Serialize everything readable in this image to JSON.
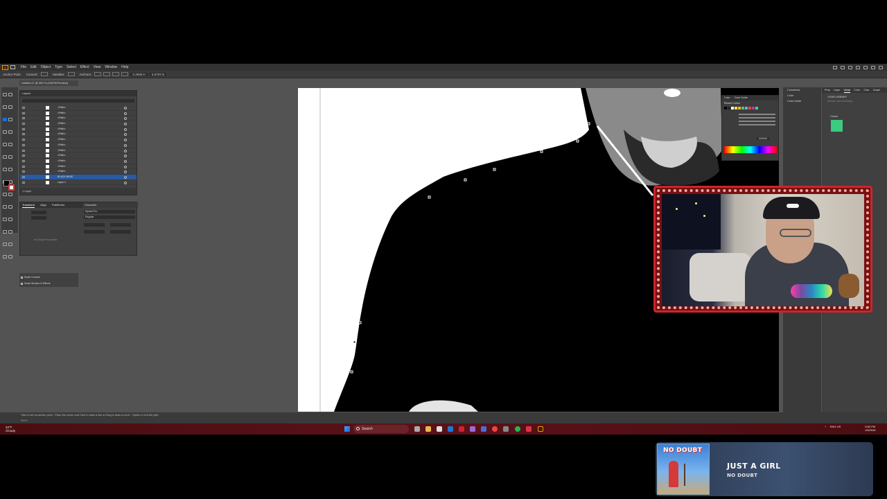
{
  "app": {
    "menu": [
      "File",
      "Edit",
      "Object",
      "Type",
      "Select",
      "Effect",
      "View",
      "Window",
      "Help"
    ],
    "control_bar": {
      "mode_label": "Anchor Point",
      "convert_label": "Convert:",
      "handles_label": "Handles:",
      "anchors_label": "Anchors:",
      "x_value": "5.3938 in",
      "y_value": "5.6703 in"
    },
    "doc_tab": "Untitled-1* @ 300 % (CMYK/Preview)"
  },
  "layers_panel": {
    "tabs": [
      "Layers"
    ],
    "rows": [
      {
        "name": "<Path>",
        "selected": false
      },
      {
        "name": "<Path>",
        "selected": false
      },
      {
        "name": "<Path>",
        "selected": false
      },
      {
        "name": "<Path>",
        "selected": false
      },
      {
        "name": "<Path>",
        "selected": false
      },
      {
        "name": "<Path>",
        "selected": false
      },
      {
        "name": "<Path>",
        "selected": false
      },
      {
        "name": "<Path>",
        "selected": false
      },
      {
        "name": "<Path>",
        "selected": false
      },
      {
        "name": "<Path>",
        "selected": false
      },
      {
        "name": "<Path>",
        "selected": false
      },
      {
        "name": "<Path>",
        "selected": false
      },
      {
        "name": "<Path>",
        "selected": false
      },
      {
        "name": "BLACK BASE",
        "selected": true
      },
      {
        "name": "Layer 1",
        "selected": false
      }
    ],
    "footer": "1 Layer"
  },
  "properties": {
    "tabs": [
      "Transform",
      "Align",
      "Pathfinder"
    ],
    "character_tab": "Character",
    "font_name": "Myriad Pro",
    "font_style": "Regular",
    "no_shape": "No Shape Properties",
    "scale_corners": "Scale Corners",
    "scale_strokes": "Scale Strokes & Effects"
  },
  "color_panel": {
    "tabs": [
      "Color",
      "Color Guide"
    ],
    "recent_label": "Recent Colors",
    "hex_value": "000000",
    "swatches": [
      "#000000",
      "#222222",
      "#ffffff",
      "#f4e04d",
      "#ffb13b",
      "#3ccb7f",
      "#7ad",
      "#e44",
      "#c39",
      "#2bd9a9"
    ]
  },
  "side_dock": {
    "items": [
      "Comments",
      "Color",
      "Color Guide"
    ]
  },
  "libraries": {
    "tabs": [
      "Prop",
      "Layer",
      "Librar",
      "Color",
      "Char",
      "Graph"
    ],
    "title": "YOUR LIBRARY",
    "search_placeholder": "Search current library",
    "colors_label": "Colors",
    "swatch_color": "#3ccb7f"
  },
  "status": {
    "hint": "Click to set an anchor point · Place the cursor and Click to draw a line or Drag to draw a curve · Option to end the path",
    "zoom": "300%"
  },
  "taskbar": {
    "weather_temp": "34°F",
    "weather_text": "Cloudy",
    "search_label": "Search",
    "lang": "ENG",
    "region": "US",
    "time": "6:50 PM",
    "date": "1/5/2026"
  },
  "now_playing": {
    "album_title": "NO DOUBT",
    "track": "JUST A GIRL",
    "artist": "NO DOUBT"
  }
}
